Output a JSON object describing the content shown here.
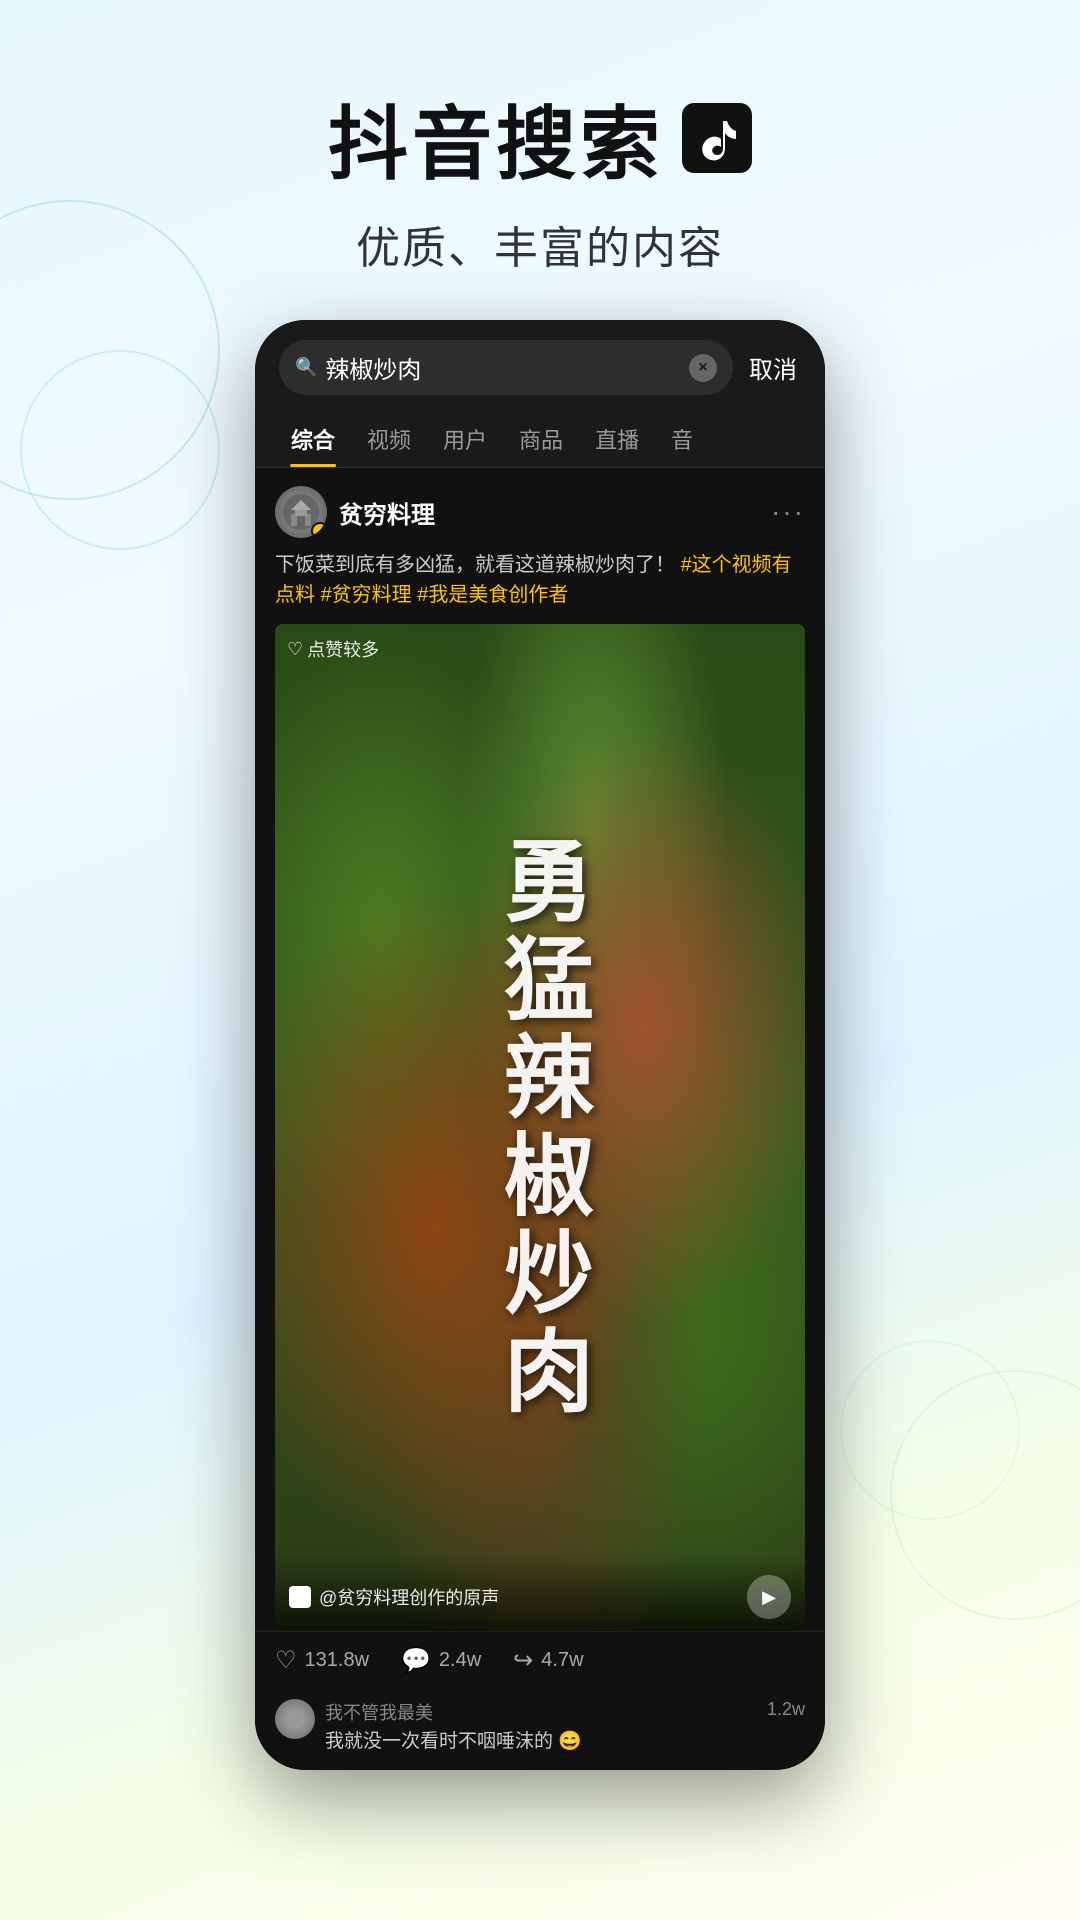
{
  "page": {
    "background": "light-blue-gradient"
  },
  "header": {
    "main_title": "抖音搜索",
    "subtitle": "优质、丰富的内容",
    "logo_alt": "TikTok logo"
  },
  "search": {
    "query": "辣椒炒肉",
    "clear_button": "×",
    "cancel_label": "取消"
  },
  "tabs": [
    {
      "label": "综合",
      "active": true
    },
    {
      "label": "视频",
      "active": false
    },
    {
      "label": "用户",
      "active": false
    },
    {
      "label": "商品",
      "active": false
    },
    {
      "label": "直播",
      "active": false
    },
    {
      "label": "音",
      "active": false
    }
  ],
  "post": {
    "username": "贫穷料理",
    "verified": true,
    "more_icon": "···",
    "description": "下饭菜到底有多凶猛，就看这道辣椒炒肉了！",
    "hashtags": [
      "#这个视频有点料",
      "#贫穷料理",
      "#我是美食创作者"
    ],
    "likes_badge": "点赞较多",
    "video_text": "勇猛辣椒炒肉",
    "audio_info": "@贫穷料理创作的原声",
    "play_icon": "▶"
  },
  "engagement": {
    "likes": "131.8w",
    "comments": "2.4w",
    "shares": "4.7w"
  },
  "comment": {
    "user": "我不管我最美",
    "text": "我就没一次看时不咽唾沫的 😄",
    "count": "1.2w"
  }
}
